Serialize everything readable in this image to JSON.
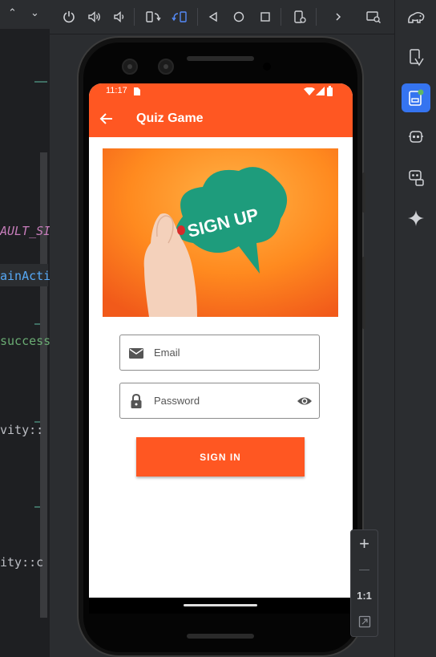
{
  "code_editor": {
    "lines": [
      {
        "text": "AULT_SI",
        "color": "#c77dbb"
      },
      {
        "text": "ainActi",
        "color": "#56a8f5"
      },
      {
        "text": "success",
        "color": "#6aab73"
      },
      {
        "text": "vity::",
        "color": "#bcbec4"
      },
      {
        "text": "ity::c",
        "color": "#bcbec4"
      }
    ]
  },
  "toolbar": {
    "icons": [
      "power-icon",
      "volume-up-icon",
      "volume-down-icon",
      "rotate-left-icon",
      "rotate-right-icon",
      "back-triangle-icon",
      "home-circle-icon",
      "overview-square-icon",
      "screenshot-settings-icon",
      "more-chevron-icon",
      "snapshot-icon"
    ]
  },
  "right_rail": {
    "icons": [
      "gradle-elephant-icon",
      "device-manager-icon",
      "running-devices-icon",
      "app-quality-icon",
      "device-mirroring-icon",
      "gemini-sparkle-icon"
    ]
  },
  "colors": {
    "accent": "#ff5722",
    "rail_active": "#3574f0"
  },
  "phone": {
    "status_time": "11:17",
    "app_title": "Quiz Game",
    "hero_text": "SIGN UP",
    "email_placeholder": "Email",
    "password_placeholder": "Password",
    "signin_label": "SIGN IN"
  },
  "zoom": {
    "plus": "+",
    "minus": "—",
    "ratio": "1:1"
  }
}
